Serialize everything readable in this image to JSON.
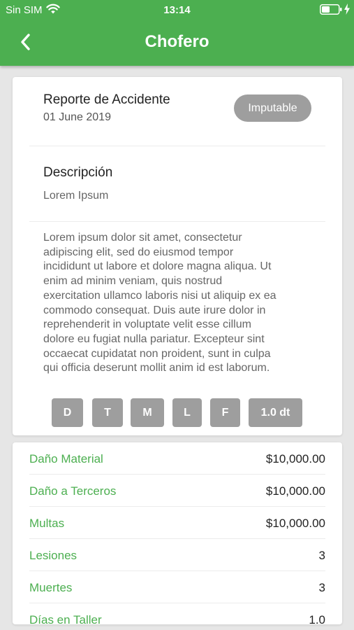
{
  "status_bar": {
    "carrier": "Sin SIM",
    "time": "13:14"
  },
  "nav": {
    "title": "Chofero"
  },
  "report": {
    "title": "Reporte de Accidente",
    "date": "01 June 2019",
    "status": "Imputable",
    "description_heading": "Descripción",
    "description_subtitle": "Lorem Ipsum",
    "body_lines": [
      "Lorem ipsum dolor sit amet, consectetur",
      "adipiscing elit, sed do eiusmod tempor",
      "incididunt ut labore et dolore magna aliqua. Ut",
      "enim ad minim veniam, quis nostrud",
      "exercitation ullamco laboris nisi ut aliquip ex ea",
      "commodo consequat. Duis aute irure dolor in",
      "reprehenderit in voluptate velit esse cillum",
      "dolore eu fugiat nulla pariatur. Excepteur sint",
      "occaecat cupidatat non proident, sunt in culpa",
      "qui officia deserunt mollit anim id est laborum."
    ],
    "tags": [
      "D",
      "T",
      "M",
      "L",
      "F",
      "1.0 dt"
    ]
  },
  "costs": [
    {
      "label": "Daño Material",
      "value": "$10,000.00"
    },
    {
      "label": "Daño a Terceros",
      "value": "$10,000.00"
    },
    {
      "label": "Multas",
      "value": "$10,000.00"
    },
    {
      "label": "Lesiones",
      "value": "3"
    },
    {
      "label": "Muertes",
      "value": "3"
    },
    {
      "label": "Días en Taller",
      "value": "1.0"
    }
  ],
  "colors": {
    "primary": "#4caf50",
    "pill": "#9e9e9e",
    "background": "#e6e6e6"
  }
}
